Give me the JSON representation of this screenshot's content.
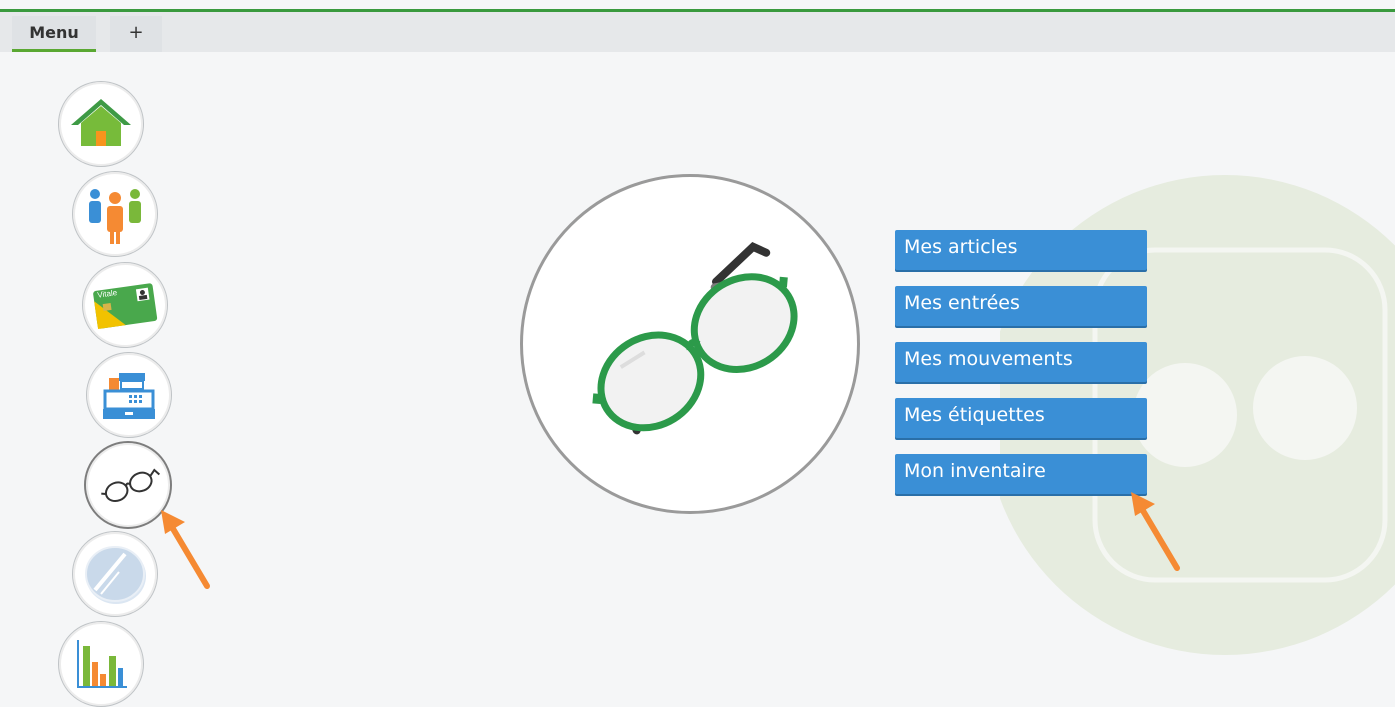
{
  "tabs": {
    "menu_label": "Menu",
    "add_label": "+"
  },
  "sidebar": {
    "items": [
      {
        "name": "home",
        "icon": "home-icon"
      },
      {
        "name": "clients",
        "icon": "people-icon"
      },
      {
        "name": "vitale",
        "icon": "vitale-card-icon",
        "card_text": "Vitale"
      },
      {
        "name": "cash-register",
        "icon": "cash-register-icon"
      },
      {
        "name": "frames",
        "icon": "glasses-icon",
        "active": true
      },
      {
        "name": "lenses",
        "icon": "lens-icon"
      },
      {
        "name": "statistics",
        "icon": "bar-chart-icon"
      }
    ]
  },
  "main": {
    "hero_icon": "glasses-icon",
    "menu": [
      {
        "label": "Mes articles"
      },
      {
        "label": "Mes entrées"
      },
      {
        "label": "Mes mouvements"
      },
      {
        "label": "Mes étiquettes"
      },
      {
        "label": "Mon inventaire"
      }
    ]
  },
  "colors": {
    "accent_green": "#3a9a3e",
    "button_blue": "#3a8fd6",
    "arrow_orange": "#f58a33"
  }
}
